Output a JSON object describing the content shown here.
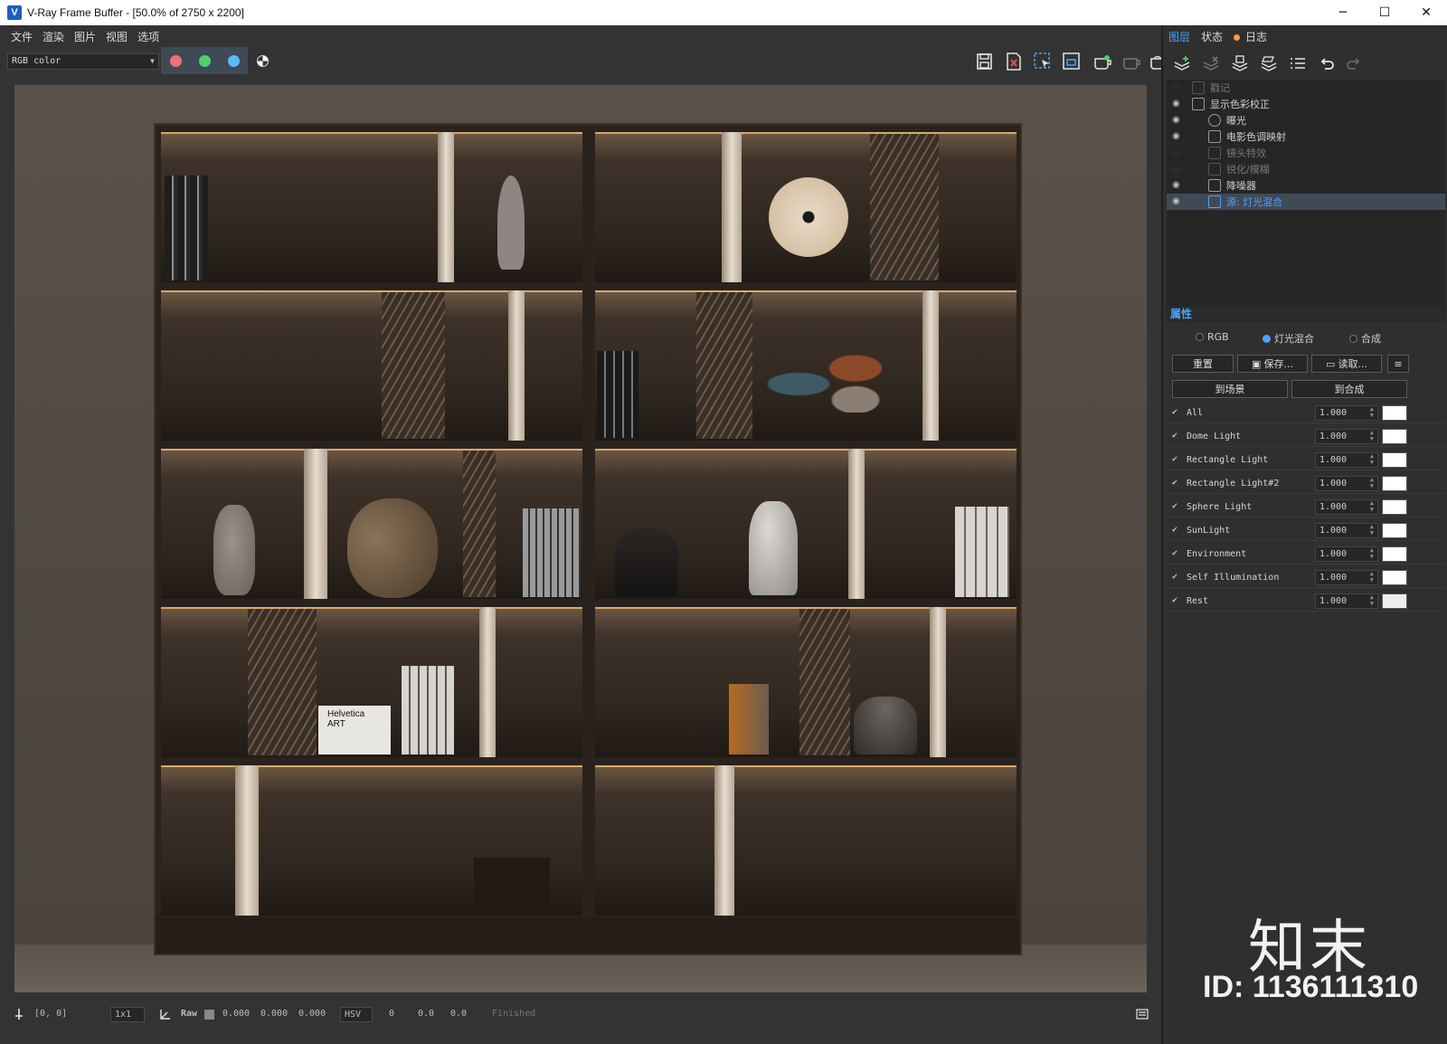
{
  "window": {
    "title": "V-Ray Frame Buffer - [50.0% of 2750 x 2200]",
    "app_icon_glyph": "V",
    "controls": [
      "─",
      "☐",
      "✕"
    ]
  },
  "menu": [
    "文件",
    "渲染",
    "图片",
    "视图",
    "选项"
  ],
  "toolbar": {
    "channel": "RGB color",
    "channel_buttons": [
      {
        "name": "red-channel",
        "color": "#f0707a"
      },
      {
        "name": "green-channel",
        "color": "#4fd06a"
      },
      {
        "name": "blue-channel",
        "color": "#59bdf5"
      },
      {
        "name": "alpha-channel",
        "color": "#ffffff"
      }
    ],
    "right_icons": [
      "save-image-icon",
      "clear-image-icon",
      "track-mouse-icon",
      "region-render-icon",
      "render-icon",
      "interactive-render-icon",
      "stop-render-icon"
    ]
  },
  "status": {
    "coords": "[0, 0]",
    "zoom": "1x1",
    "mode": "Raw",
    "r": "0.000",
    "g": "0.000",
    "b": "0.000",
    "color_space": "HSV",
    "h": "0",
    "s": "0.0",
    "v": "0.0",
    "state": "Finished"
  },
  "panel": {
    "tabs": [
      {
        "label": "图层",
        "active": true
      },
      {
        "label": "状态",
        "active": false
      },
      {
        "label": "日志",
        "active": false,
        "dot": true
      }
    ],
    "tool_icons": [
      "create-layer-icon",
      "delete-layer-icon",
      "save-layer-tree-icon",
      "load-layer-tree-icon",
      "layer-presets-icon",
      "undo-icon",
      "redo-icon"
    ],
    "layers": [
      {
        "label": "戳记",
        "indent": 0,
        "visible": false,
        "dim": true
      },
      {
        "label": "显示色彩校正",
        "indent": 0,
        "visible": true
      },
      {
        "label": "曝光",
        "indent": 1,
        "visible": true
      },
      {
        "label": "电影色调映射",
        "indent": 1,
        "visible": true
      },
      {
        "label": "镜头特效",
        "indent": 1,
        "visible": false,
        "dim": true
      },
      {
        "label": "锐化/模糊",
        "indent": 1,
        "visible": false,
        "dim": true
      },
      {
        "label": "降噪器",
        "indent": 1,
        "visible": true
      },
      {
        "label": "源: 灯光混合",
        "indent": 1,
        "visible": true,
        "selected": true
      }
    ],
    "properties_title": "属性",
    "radio": [
      {
        "label": "RGB",
        "on": false
      },
      {
        "label": "灯光混合",
        "on": true
      },
      {
        "label": "合成",
        "on": false
      }
    ],
    "buttons": {
      "reset": "重置",
      "save": "保存...",
      "load": "读取...",
      "to_scene": "到场景",
      "to_composite": "到合成"
    },
    "lights": [
      {
        "name": "All",
        "value": "1.000"
      },
      {
        "name": "Dome Light",
        "value": "1.000"
      },
      {
        "name": "Rectangle Light",
        "value": "1.000"
      },
      {
        "name": "Rectangle Light#2",
        "value": "1.000"
      },
      {
        "name": "Sphere Light",
        "value": "1.000"
      },
      {
        "name": "SunLight",
        "value": "1.000"
      },
      {
        "name": "Environment",
        "value": "1.000"
      },
      {
        "name": "Self Illumination",
        "value": "1.000"
      },
      {
        "name": "Rest",
        "value": "1.000"
      }
    ]
  },
  "render": {
    "book_labels": [
      "Helvetica",
      "ART"
    ]
  },
  "watermark": {
    "logo": "知末",
    "id": "ID: 1136111310"
  }
}
